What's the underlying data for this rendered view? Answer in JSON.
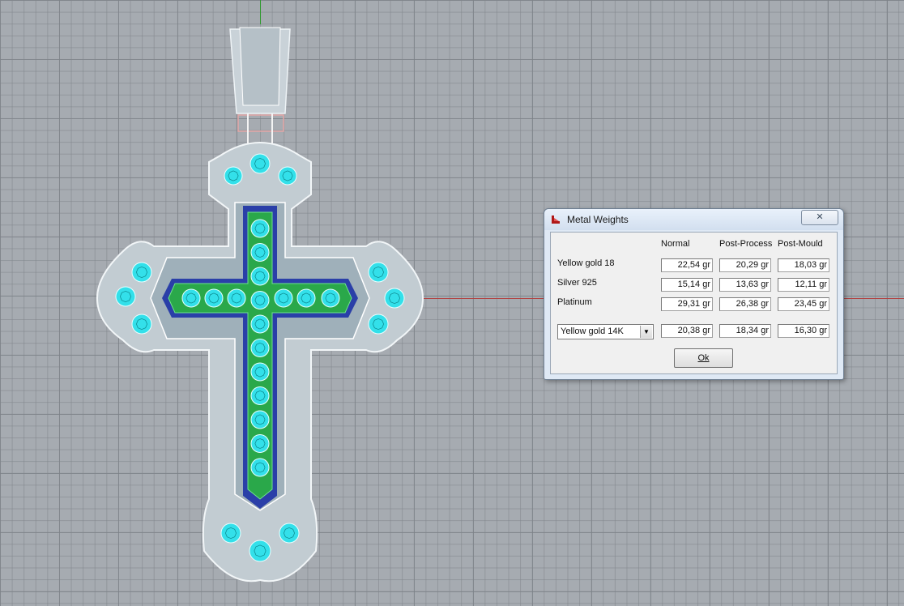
{
  "dialog": {
    "title": "Metal Weights",
    "close_glyph": "✕",
    "columns": [
      "Normal",
      "Post-Process",
      "Post-Mould"
    ],
    "rows": [
      {
        "label": "Yellow gold 18",
        "values": [
          "22,54 gr",
          "20,29 gr",
          "18,03 gr"
        ]
      },
      {
        "label": "Silver 925",
        "values": [
          "15,14 gr",
          "13,63 gr",
          "12,11 gr"
        ]
      },
      {
        "label": "Platinum",
        "values": [
          "29,31 gr",
          "26,38 gr",
          "23,45 gr"
        ]
      }
    ],
    "custom_row": {
      "selected_metal": "Yellow gold 14K",
      "values": [
        "20,38 gr",
        "18,34 gr",
        "16,30 gr"
      ]
    },
    "ok_label": "Ok"
  },
  "viewport": {
    "background": "#a6abb1",
    "x_axis_color": "#b24040",
    "y_axis_color": "#2f9a2f",
    "gem_color": "#33e0ea",
    "channel_color": "#2aa84a",
    "metal_color": "#c4cdd3"
  }
}
